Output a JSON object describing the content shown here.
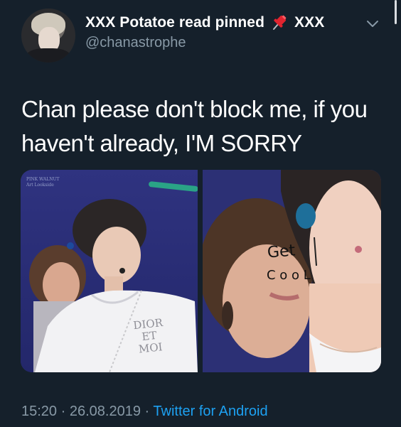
{
  "tweet": {
    "author": {
      "display_name": "XXX Potatoe read pinned",
      "pin_emoji": "pin-icon",
      "suffix": "XXX",
      "handle": "@chanastrophe"
    },
    "text": "Chan please don't block me, if you haven't already, I'M SORRY",
    "media": {
      "left_photo_credit": [
        "PINK WALNUT",
        "Art Lookside"
      ],
      "shirt_print": [
        "DIOR",
        "ET",
        "MOI"
      ],
      "doodle_line1": "Get",
      "doodle_line2": "C o o L"
    },
    "meta": {
      "time": "15:20",
      "separator": "·",
      "date": "26.08.2019",
      "source": "Twitter for Android"
    }
  },
  "colors": {
    "background": "#15202b",
    "text_primary": "#ffffff",
    "text_secondary": "#8899a6",
    "link": "#1da1f2"
  },
  "icons": {
    "more": "chevron-down-icon",
    "pin": "pushpin-icon"
  }
}
